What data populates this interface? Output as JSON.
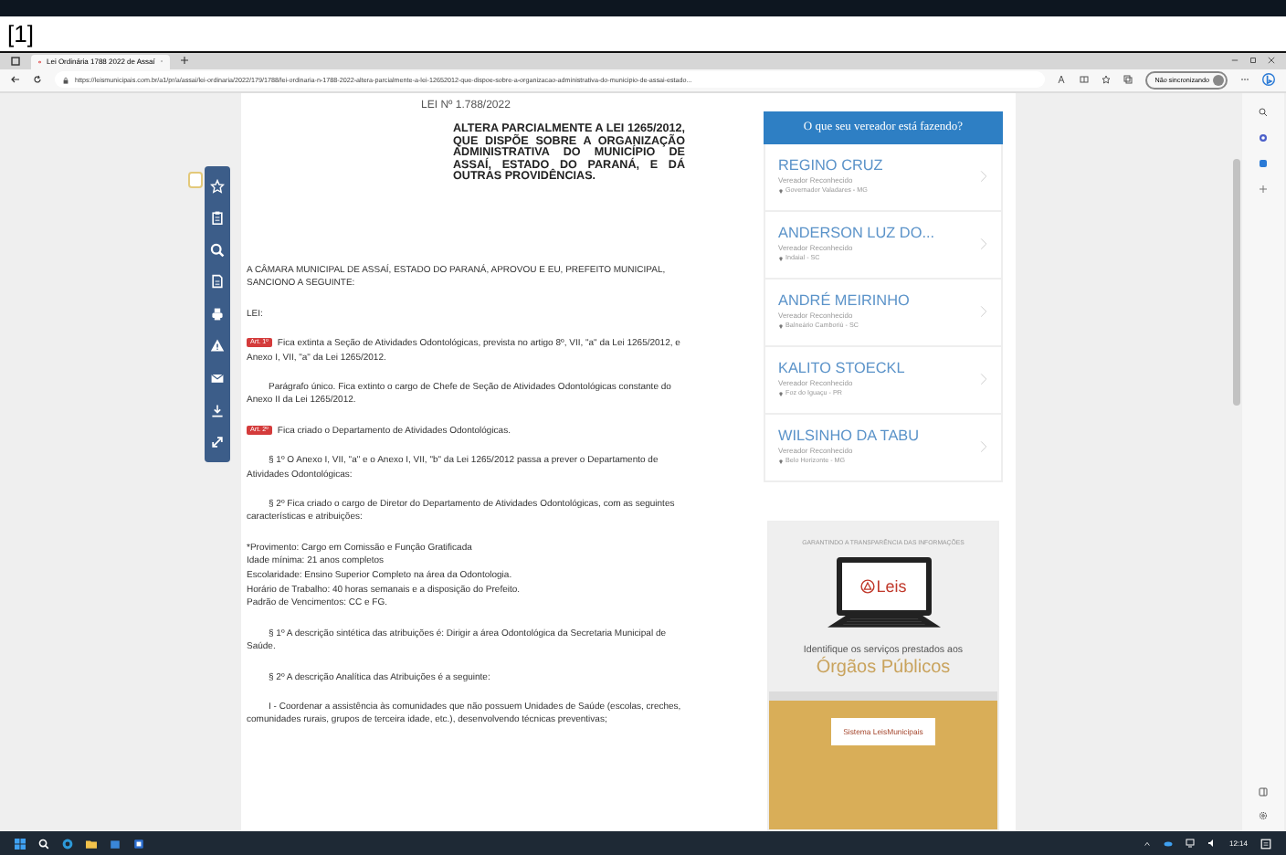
{
  "label": "[1]",
  "browser": {
    "tab": {
      "title": "Lei Ordinária 1788 2022 de Assaí",
      "selected": true
    },
    "address": "https://leismunicipais.com.br/a1/pr/a/assai/lei-ordinaria/2022/179/1788/lei-ordinaria-n-1788-2022-altera-parcialmente-a-lei-12652012-que-dispoe-sobre-a-organizacao-administrativa-do-municipio-de-assai-estado...",
    "profile": "Não sincronizando"
  },
  "document": {
    "title": "LEI Nº 1.788/2022",
    "heading": "ALTERA PARCIALMENTE A LEI 1265/2012, QUE DISPÕE SOBRE A ORGANIZAÇÃO ADMINISTRATIVA DO MUNICÍPIO DE ASSAÍ, ESTADO DO PARANÁ, E DÁ OUTRAS PROVIDÊNCIAS.",
    "paragraphs": [
      {
        "kind": "plain",
        "text": "A CÂMARA MUNICIPAL DE ASSAÍ, ESTADO DO PARANÁ, APROVOU E EU, PREFEITO MUNICIPAL, SANCIONO A SEGUINTE:"
      },
      {
        "kind": "plain",
        "text": "LEI:"
      },
      {
        "kind": "article",
        "badge": "Art. 1º",
        "text": "Fica extinta a Seção de Atividades Odontológicas, prevista no artigo 8º, VII, \"a\" da Lei 1265/2012, e Anexo I, VII, \"a\" da Lei 1265/2012."
      },
      {
        "kind": "indented",
        "text": "Parágrafo único. Fica extinto o cargo de Chefe de Seção de Atividades Odontológicas constante do Anexo II da Lei 1265/2012."
      },
      {
        "kind": "article",
        "badge": "Art. 2º",
        "text": "Fica criado o Departamento de Atividades Odontológicas."
      },
      {
        "kind": "indented",
        "text": "§ 1º O Anexo I, VII, \"a\" e o Anexo I, VII, \"b\" da Lei 1265/2012 passa a prever o Departamento de Atividades Odontológicas:"
      },
      {
        "kind": "indented",
        "text": "§ 2º Fica criado o cargo de Diretor do Departamento de Atividades Odontológicas, com as seguintes características e atribuições:"
      },
      {
        "kind": "list",
        "lines": [
          "*Provimento: Cargo em Comissão e Função Gratificada",
          "Idade mínima: 21 anos completos",
          "Escolaridade: Ensino Superior Completo na área da Odontologia.",
          "Horário de Trabalho: 40 horas semanais e a disposição do Prefeito.",
          "Padrão de Vencimentos: CC e FG."
        ]
      },
      {
        "kind": "indented",
        "text": "§ 1º A descrição sintética das atribuições é: Dirigir a área Odontológica da Secretaria Municipal de Saúde."
      },
      {
        "kind": "indented",
        "text": "§ 2º A descrição Analítica das Atribuições é a seguinte:"
      },
      {
        "kind": "indented",
        "text": "I - Coordenar a assistência às comunidades que não possuem Unidades de Saúde (escolas, creches, comunidades rurais, grupos de terceira idade, etc.), desenvolvendo técnicas preventivas;"
      }
    ]
  },
  "sidebar": {
    "header": "O que seu vereador está fazendo?",
    "councillors": [
      {
        "name": "REGINO CRUZ",
        "role": "Vereador Reconhecido",
        "location": "Governador Valadares - MG"
      },
      {
        "name": "ANDERSON LUZ DO...",
        "role": "Vereador Reconhecido",
        "location": "Indaial - SC"
      },
      {
        "name": "ANDRÉ MEIRINHO",
        "role": "Vereador Reconhecido",
        "location": "Balneário Camboriú - SC"
      },
      {
        "name": "KALITO STOECKL",
        "role": "Vereador Reconhecido",
        "location": "Foz do Iguaçu - PR"
      },
      {
        "name": "WILSINHO DA TABU",
        "role": "Vereador Reconhecido",
        "location": "Belo Horizonte - MG"
      }
    ]
  },
  "ad": {
    "tagline": "GARANTINDO A TRANSPARÊNCIA DAS INFORMAÇÕES",
    "logo": "Leis",
    "text": "Identifique os serviços prestados aos",
    "highlight": "Órgãos Públicos",
    "button": "Sistema LeisMunicipais"
  },
  "taskbar": {
    "time": "12:14"
  }
}
